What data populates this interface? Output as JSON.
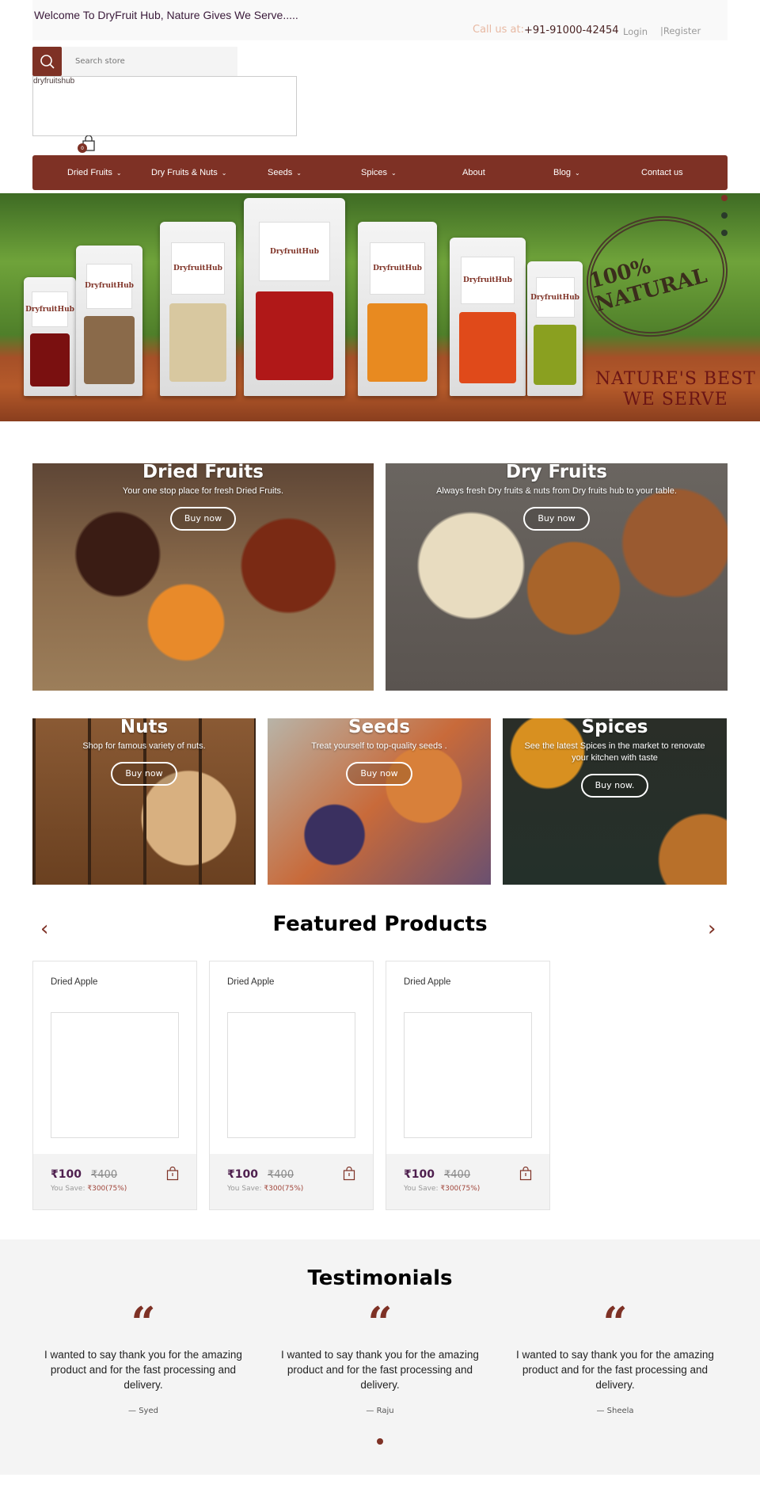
{
  "topbar": {
    "welcome": "Welcome To DryFruit Hub, Nature Gives We Serve.....",
    "call_label": "Call us at:",
    "phone": "+91-91000-42454",
    "login": "Login",
    "register": "|Register"
  },
  "search": {
    "placeholder": "Search store",
    "icon": "search-icon"
  },
  "logo": {
    "alt_text": "dryfruitshub"
  },
  "cart": {
    "count": "0",
    "icon": "shopping-bag-icon"
  },
  "nav": {
    "items": [
      {
        "label": "Dried Fruits",
        "has_dropdown": true
      },
      {
        "label": "Dry Fruits & Nuts",
        "has_dropdown": true
      },
      {
        "label": "Seeds",
        "has_dropdown": true
      },
      {
        "label": "Spices",
        "has_dropdown": true
      },
      {
        "label": "About",
        "has_dropdown": false
      },
      {
        "label": "Blog",
        "has_dropdown": true
      },
      {
        "label": "Contact us",
        "has_dropdown": false
      }
    ],
    "chevron": "⌄"
  },
  "hero": {
    "stamp_text": "100% NATURAL",
    "tagline_line1": "NATURE'S BEST",
    "tagline_line2": "WE SERVE",
    "brand": "DryfruitHub",
    "slides": 3,
    "active_slide": 1
  },
  "categories": [
    {
      "title": "Dried Fruits",
      "subtitle": "Your one stop place for fresh Dried Fruits.",
      "button": "Buy now"
    },
    {
      "title": "Dry Fruits",
      "subtitle": "Always fresh Dry fruits & nuts from Dry fruits hub to your table.",
      "button": "Buy now"
    },
    {
      "title": "Nuts",
      "subtitle": "Shop for famous variety of nuts.",
      "button": "Buy now"
    },
    {
      "title": "Seeds",
      "subtitle": "Treat yourself to top-quality seeds .",
      "button": "Buy now"
    },
    {
      "title": "Spices",
      "subtitle": "See the latest Spices in the market to renovate your kitchen with taste",
      "button": "Buy now."
    }
  ],
  "featured": {
    "title": "Featured Products",
    "prev": "‹",
    "next": "›",
    "products": [
      {
        "name": "Dried Apple",
        "price": "₹100",
        "old_price": "₹400",
        "save_label": "You Save:",
        "save_value": "₹300(75%)"
      },
      {
        "name": "Dried Apple",
        "price": "₹100",
        "old_price": "₹400",
        "save_label": "You Save:",
        "save_value": "₹300(75%)"
      },
      {
        "name": "Dried Apple",
        "price": "₹100",
        "old_price": "₹400",
        "save_label": "You Save:",
        "save_value": "₹300(75%)"
      }
    ]
  },
  "testimonials": {
    "title": "Testimonials",
    "quote_mark": "“",
    "items": [
      {
        "text": "I wanted to say thank you for the amazing product and for the fast processing and delivery.",
        "author": "— Syed"
      },
      {
        "text": "I wanted to say thank you for the amazing product and for the fast processing and delivery.",
        "author": "— Raju"
      },
      {
        "text": "I wanted to say thank you for the amazing product and for the fast processing and delivery.",
        "author": "— Sheela"
      }
    ]
  },
  "colors": {
    "brand": "#7e3125",
    "price": "#4e1f4e",
    "call_label": "#e8b9a3"
  }
}
